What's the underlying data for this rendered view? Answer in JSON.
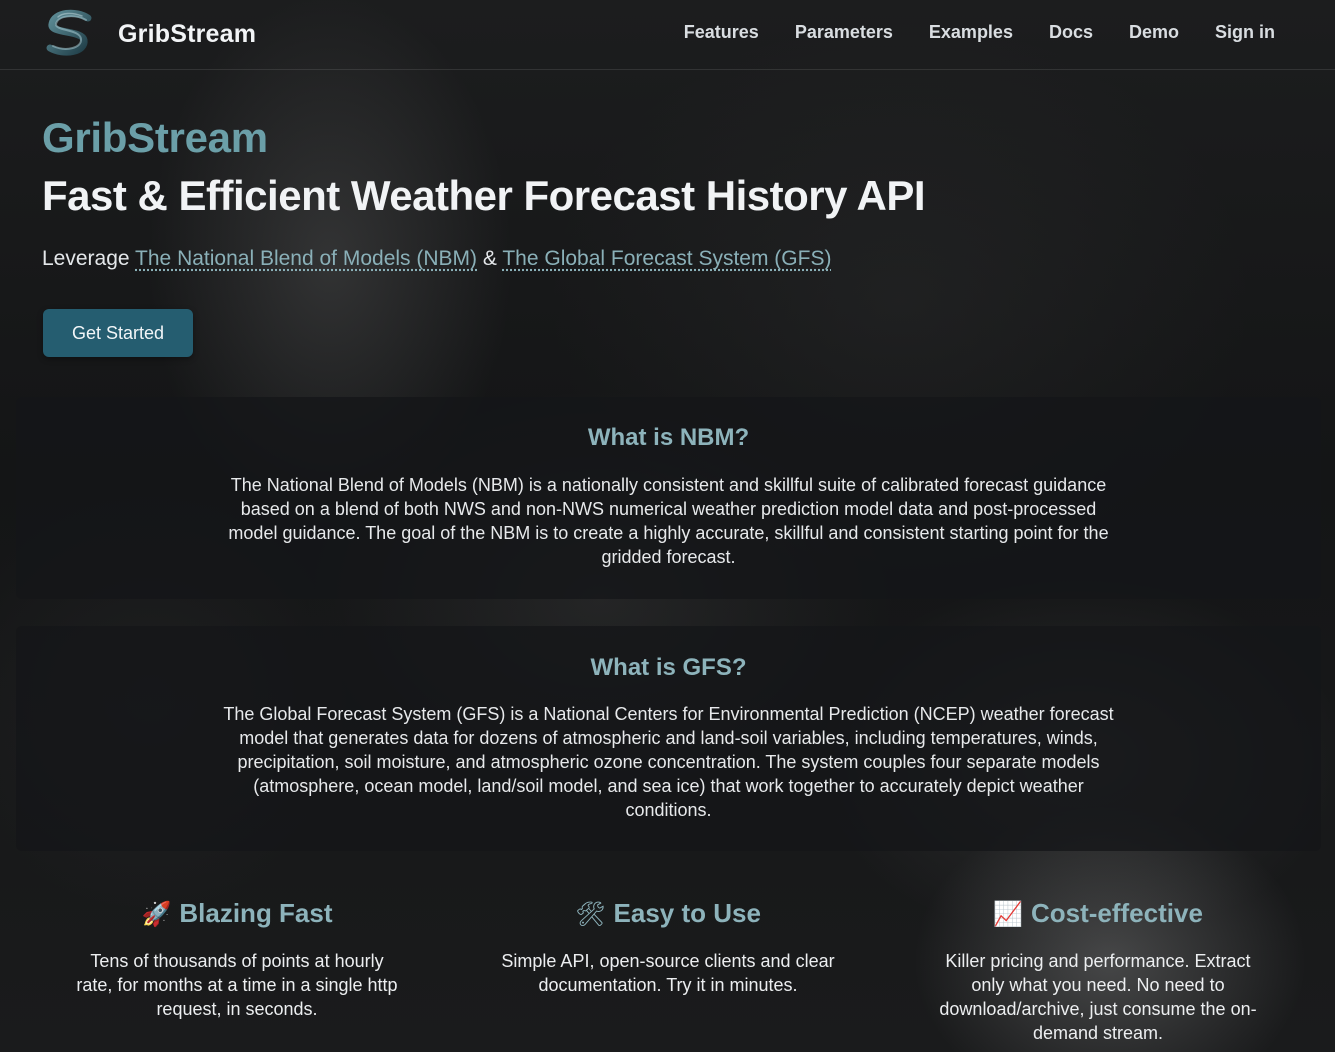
{
  "header": {
    "brand": "GribStream",
    "nav": [
      "Features",
      "Parameters",
      "Examples",
      "Docs",
      "Demo",
      "Sign in"
    ]
  },
  "hero": {
    "kicker": "GribStream",
    "title": "Fast & Efficient Weather Forecast History API",
    "leverage_prefix": "Leverage",
    "link_nbm": "The National Blend of Models (NBM)",
    "joiner": "&",
    "link_gfs": "The Global Forecast System (GFS)",
    "cta": "Get Started"
  },
  "nbm": {
    "title": "What is NBM?",
    "text": "The National Blend of Models (NBM) is a nationally consistent and skillful suite of calibrated forecast guidance based on a blend of both NWS and non-NWS numerical weather prediction model data and post-processed model guidance. The goal of the NBM is to create a highly accurate, skillful and consistent starting point for the gridded forecast."
  },
  "gfs": {
    "title": "What is GFS?",
    "text": "The Global Forecast System (GFS) is a National Centers for Environmental Prediction (NCEP) weather forecast model that generates data for dozens of atmospheric and land-soil variables, including temperatures, winds, precipitation, soil moisture, and atmospheric ozone concentration. The system couples four separate models (atmosphere, ocean model, land/soil model, and sea ice) that work together to accurately depict weather conditions."
  },
  "features": [
    {
      "icon": "rocket-icon",
      "emoji": "🚀",
      "title": "Blazing Fast",
      "text": "Tens of thousands of points at hourly rate, for months at a time in a single http request, in seconds."
    },
    {
      "icon": "tools-icon",
      "emoji": "🛠",
      "title": "Easy to Use",
      "text": "Simple API, open-source clients and clear documentation. Try it in minutes."
    },
    {
      "icon": "chart-increasing-icon",
      "emoji": "📈",
      "title": "Cost-effective",
      "text": "Killer pricing and performance. Extract only what you need. No need to download/archive, just consume the on-demand stream."
    }
  ],
  "colors": {
    "accent": "#6b9fa8",
    "heading": "#8db3bb",
    "button": "#255d70",
    "background": "#151617"
  }
}
